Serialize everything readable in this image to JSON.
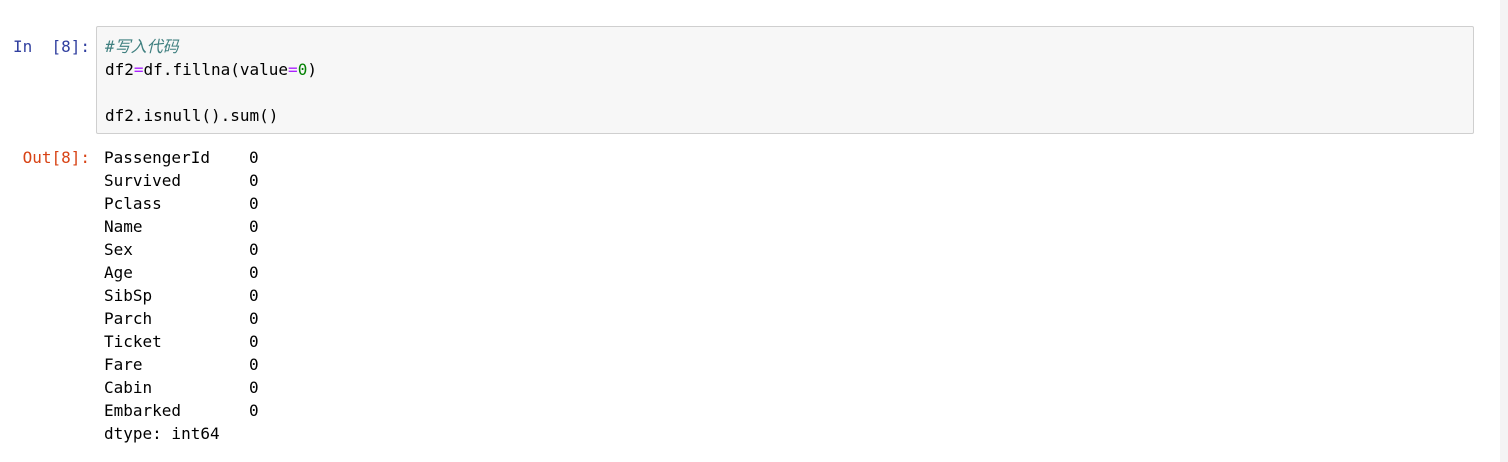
{
  "input_prompt": "In  [8]:",
  "output_prompt": "Out[8]:",
  "code": {
    "line1_comment": "#写入代码",
    "line2_lhs": "df2",
    "line2_eq": "=",
    "line2_call": "df.fillna(value",
    "line2_eq2": "=",
    "line2_num": "0",
    "line2_close": ")",
    "line3": "",
    "line4": "df2.isnull().sum()"
  },
  "output": {
    "rows": [
      {
        "name": "PassengerId",
        "value": "0"
      },
      {
        "name": "Survived",
        "value": "0"
      },
      {
        "name": "Pclass",
        "value": "0"
      },
      {
        "name": "Name",
        "value": "0"
      },
      {
        "name": "Sex",
        "value": "0"
      },
      {
        "name": "Age",
        "value": "0"
      },
      {
        "name": "SibSp",
        "value": "0"
      },
      {
        "name": "Parch",
        "value": "0"
      },
      {
        "name": "Ticket",
        "value": "0"
      },
      {
        "name": "Fare",
        "value": "0"
      },
      {
        "name": "Cabin",
        "value": "0"
      },
      {
        "name": "Embarked",
        "value": "0"
      }
    ],
    "dtype": "dtype: int64"
  }
}
